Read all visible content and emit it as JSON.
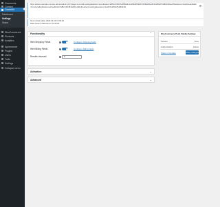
{
  "sidebar": {
    "items_top": [
      {
        "label": "Comments",
        "icon": "comments-icon"
      },
      {
        "label": "Contact",
        "icon": "contact-icon"
      }
    ],
    "active": {
      "label": "CommKit",
      "icon": "commkit-icon"
    },
    "submenu": [
      {
        "label": "Dashboard",
        "current": false
      },
      {
        "label": "Settings",
        "current": true
      },
      {
        "label": "Status",
        "current": false
      }
    ],
    "items_bottom": [
      {
        "label": "WooCommerce",
        "icon": "woocommerce-icon"
      },
      {
        "label": "Products",
        "icon": "products-icon"
      },
      {
        "label": "Analytics",
        "icon": "analytics-icon"
      },
      {
        "label": "Appearance",
        "icon": "appearance-icon"
      },
      {
        "label": "Plugins",
        "icon": "plugins-icon"
      },
      {
        "label": "Users",
        "icon": "users-icon"
      },
      {
        "label": "Tools",
        "icon": "tools-icon"
      },
      {
        "label": "Settings",
        "icon": "settings-icon"
      },
      {
        "label": "Collapse menu",
        "icon": "collapse-icon"
      }
    ]
  },
  "notices": {
    "url_notice": "https://www.example.com/wp-admin/admin.php?page=commkit-settings&action=sync&token=a8f3c21b9d7e4f60a5c1e2b3d4f5a6b7c8d9e0f1a2b3c4d5e6f7a8b9c0d1e2f3&referrer=dashboard&tab=functionality&status=active&hash=9f8e7d6c5b4a3f2e1d0c&redirect=settings&session=1a2b3c4d5e6f7a8b9c0d",
    "date_line_1": "Next refresh date: 2023-02-13 13:36:32",
    "date_line_2": "Date issued: 2023-02-12 13:36:32"
  },
  "functionality": {
    "title": "Functionality",
    "rows": [
      {
        "label": "Web Shipping Fields",
        "link": "Configure shipping fields",
        "enabled": true
      },
      {
        "label": "Web Billing Fields",
        "link": "Configure billing fields",
        "enabled": true
      }
    ],
    "results_label": "Results returned",
    "results_value": "0"
  },
  "collapsed_panels": [
    {
      "title": "Activation"
    },
    {
      "title": "Advanced"
    }
  ],
  "side_panel": {
    "title": "WooCommerce Point Fidelity Settings",
    "rows": [
      {
        "key": "Version",
        "value": "Free"
      },
      {
        "key": "Authorization",
        "value": "Active"
      }
    ],
    "link": "Status & Update",
    "save_label": "Save changes"
  },
  "colors": {
    "accent": "#2271b1",
    "sidebar": "#1d2327",
    "background": "#f0f0f1"
  }
}
